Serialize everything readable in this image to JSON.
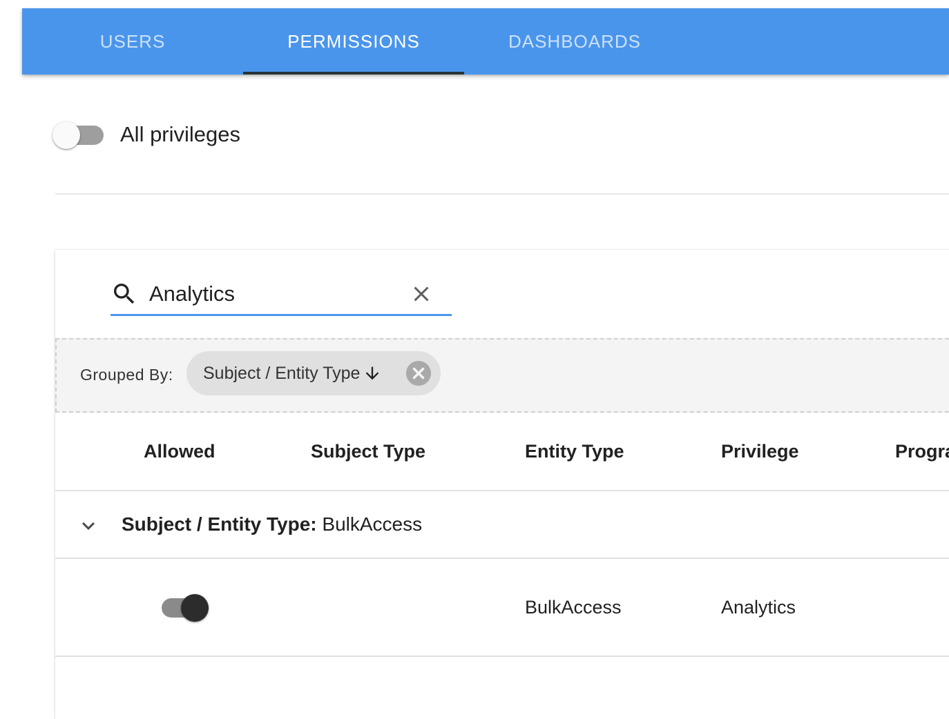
{
  "tabs": [
    {
      "label": "USERS",
      "active": false
    },
    {
      "label": "PERMISSIONS",
      "active": true
    },
    {
      "label": "DASHBOARDS",
      "active": false
    }
  ],
  "all_privileges": {
    "label": "All privileges",
    "enabled": false
  },
  "search": {
    "value": "Analytics",
    "icon": "search-icon",
    "clear_icon": "close-icon"
  },
  "grouping": {
    "label": "Grouped By:",
    "chip_label": "Subject / Entity Type",
    "chip_sort_icon": "arrow-down-icon",
    "chip_remove_icon": "cancel-circle-icon"
  },
  "table": {
    "columns": [
      "Allowed",
      "Subject Type",
      "Entity Type",
      "Privilege",
      "Progra"
    ],
    "group": {
      "key_label": "Subject / Entity Type:",
      "value": "BulkAccess",
      "expanded": true
    },
    "rows": [
      {
        "allowed": true,
        "subject_type": "",
        "entity_type": "BulkAccess",
        "privilege": "Analytics"
      }
    ]
  },
  "colors": {
    "appbar": "#4a95ec",
    "tab_indicator": "#263238",
    "search_underline": "#4a95ec"
  }
}
